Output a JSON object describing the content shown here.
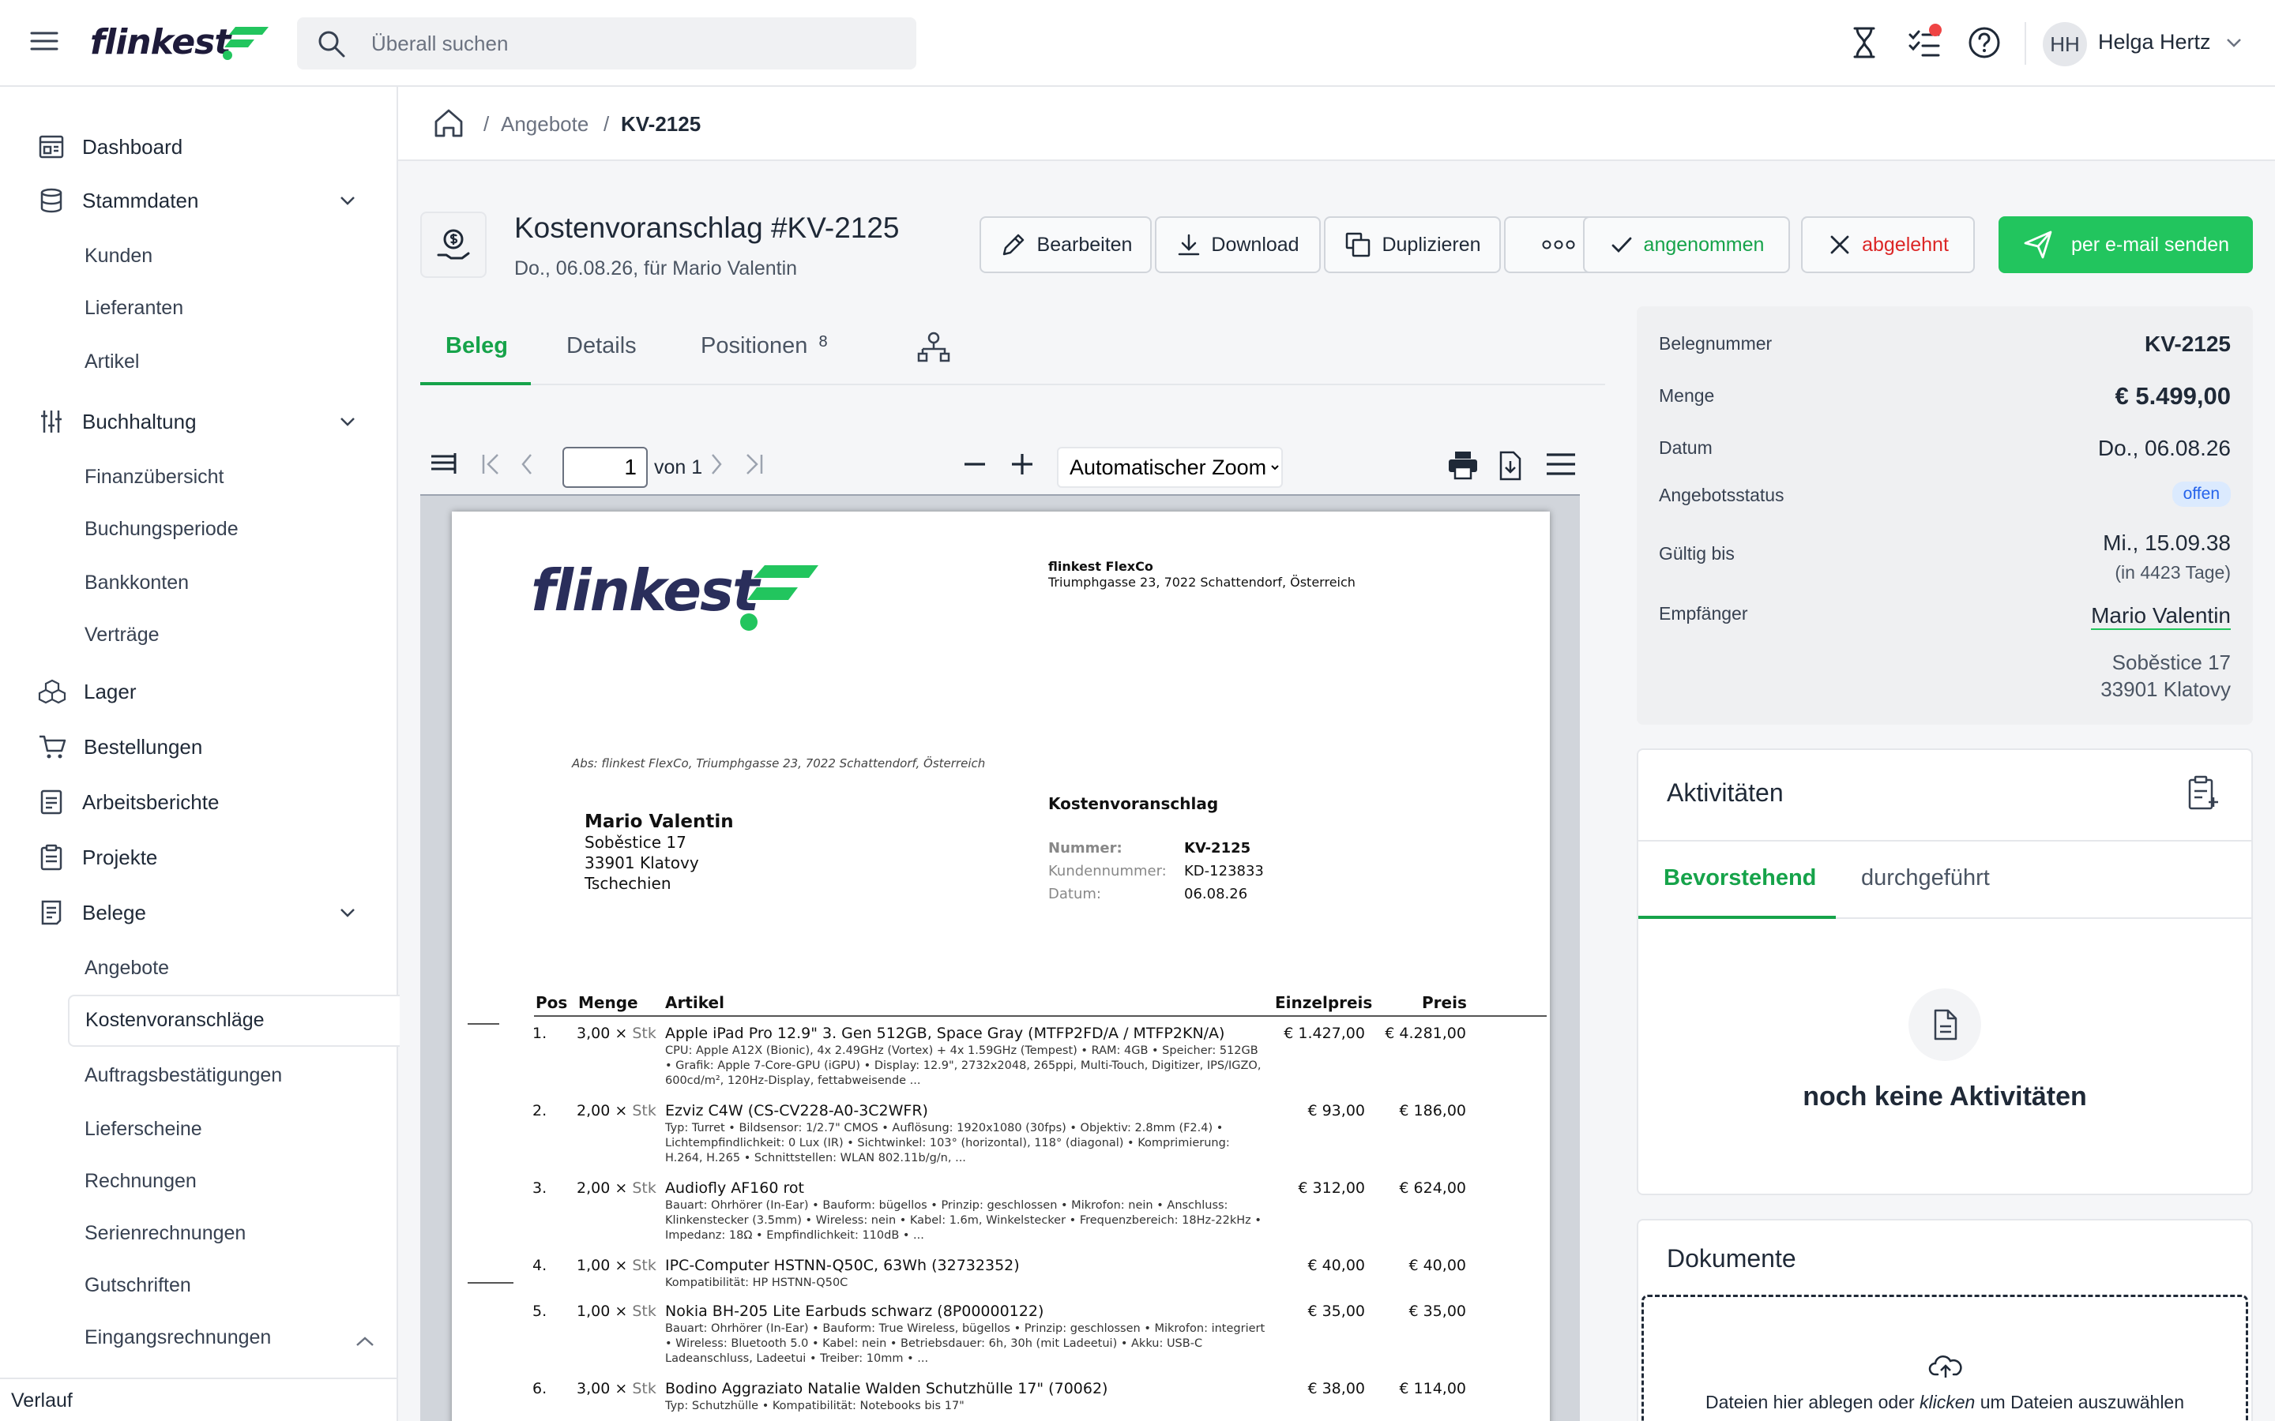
{
  "app": {
    "logo": "flinkest",
    "search_placeholder": "Überall suchen",
    "user_initials": "HH",
    "user_name": "Helga Hertz"
  },
  "sidebar": {
    "items": [
      {
        "label": "Dashboard",
        "icon": "dashboard-icon"
      },
      {
        "label": "Stammdaten",
        "icon": "database-icon",
        "expanded": true
      },
      {
        "label": "Buchhaltung",
        "icon": "sliders-icon",
        "expanded": true
      },
      {
        "label": "Lager",
        "icon": "boxes-icon"
      },
      {
        "label": "Bestellungen",
        "icon": "cart-icon"
      },
      {
        "label": "Arbeitsberichte",
        "icon": "report-icon"
      },
      {
        "label": "Projekte",
        "icon": "clipboard-icon"
      },
      {
        "label": "Belege",
        "icon": "receipt-icon",
        "expanded": true
      }
    ],
    "stammdaten_sub": [
      "Kunden",
      "Lieferanten",
      "Artikel"
    ],
    "buchhaltung_sub": [
      "Finanzübersicht",
      "Buchungsperiode",
      "Bankkonten",
      "Verträge"
    ],
    "belege_sub": [
      "Angebote",
      "Kostenvoranschläge",
      "Auftragsbestätigungen",
      "Lieferscheine",
      "Rechnungen",
      "Serienrechnungen",
      "Gutschriften",
      "Eingangsrechnungen"
    ],
    "active_sub": "Kostenvoranschläge",
    "footer": "Verlauf"
  },
  "breadcrumb": {
    "items": [
      "Angebote",
      "KV-2125"
    ]
  },
  "header": {
    "title": "Kostenvoranschlag #KV-2125",
    "subtitle": "Do., 06.08.26, für Mario Valentin",
    "buttons": {
      "edit": "Bearbeiten",
      "download": "Download",
      "duplicate": "Duplizieren",
      "accepted": "angenommen",
      "rejected": "abgelehnt",
      "email": "per e-mail senden"
    }
  },
  "tabs": {
    "beleg": "Beleg",
    "details": "Details",
    "positionen": "Positionen",
    "positionen_count": "8"
  },
  "pdf_viewer": {
    "page": "1",
    "page_of": "von 1",
    "zoom_options": [
      "Automatischer Zoom"
    ],
    "zoom": "Automatischer Zoom"
  },
  "pdf": {
    "logo": "flinkest",
    "company_name": "flinkest FlexCo",
    "company_address": "Triumphgasse 23, 7022 Schattendorf, Österreich",
    "sender_line": "Abs: flinkest FlexCo, Triumphgasse 23, 7022 Schattendorf, Österreich",
    "recipient": {
      "name": "Mario Valentin",
      "street": "Soběstice 17",
      "city": "33901 Klatovy",
      "country": "Tschechien"
    },
    "doc_type": "Kostenvoranschlag",
    "meta": [
      {
        "key": "Nummer:",
        "value": "KV-2125"
      },
      {
        "key": "Kundennummer:",
        "value": "KD-123833"
      },
      {
        "key": "Datum:",
        "value": "06.08.26"
      }
    ],
    "columns": [
      "Pos",
      "Menge",
      "Artikel",
      "Einzelpreis",
      "Preis"
    ],
    "unit": "Stk",
    "rows": [
      {
        "pos": "1.",
        "menge": "3,00 ×",
        "title": "Apple iPad Pro 12.9\" 3. Gen 512GB, Space Gray (MTFP2FD/A / MTFP2KN/A)",
        "desc": "CPU: Apple A12X (Bionic), 4x 2.49GHz (Vortex) + 4x 1.59GHz (Tempest) • RAM: 4GB • Speicher: 512GB • Grafik: Apple 7-Core-GPU (iGPU) • Display: 12.9\", 2732x2048, 265ppi, Multi-Touch, Digitizer, IPS/IGZO, 600cd/m², 120Hz-Display, fettabweisende ...",
        "einzel": "€ 1.427,00",
        "preis": "€ 4.281,00"
      },
      {
        "pos": "2.",
        "menge": "2,00 ×",
        "title": "Ezviz C4W (CS-CV228-A0-3C2WFR)",
        "desc": "Typ: Turret • Bildsensor: 1/2.7\" CMOS • Auflösung: 1920x1080 (30fps) • Objektiv: 2.8mm (F2.4) • Lichtempfindlichkeit: 0 Lux (IR) • Sichtwinkel: 103° (horizontal), 118° (diagonal) • Komprimierung: H.264, H.265 • Schnittstellen: WLAN 802.11b/g/n, ...",
        "einzel": "€ 93,00",
        "preis": "€ 186,00"
      },
      {
        "pos": "3.",
        "menge": "2,00 ×",
        "title": "Audiofly AF160 rot",
        "desc": "Bauart: Ohrhörer (In-Ear) • Bauform: bügellos • Prinzip: geschlossen • Mikrofon: nein • Anschluss: Klinkenstecker (3.5mm) • Wireless: nein • Kabel: 1.6m, Winkelstecker • Frequenzbereich: 18Hz-22kHz • Impedanz: 18Ω • Empfindlichkeit: 110dB • ...",
        "einzel": "€ 312,00",
        "preis": "€ 624,00"
      },
      {
        "pos": "4.",
        "menge": "1,00 ×",
        "title": "IPC-Computer HSTNN-Q50C, 63Wh (32732352)",
        "desc": "Kompatibilität: HP HSTNN-Q50C",
        "einzel": "€ 40,00",
        "preis": "€ 40,00"
      },
      {
        "pos": "5.",
        "menge": "1,00 ×",
        "title": "Nokia BH-205 Lite Earbuds schwarz (8P00000122)",
        "desc": "Bauart: Ohrhörer (In-Ear) • Bauform: True Wireless, bügellos • Prinzip: geschlossen • Mikrofon: integriert • Wireless: Bluetooth 5.0 • Kabel: nein • Betriebsdauer: 6h, 30h (mit Ladeetui) • Akku: USB-C Ladeanschluss, Ladeetui • Treiber: 10mm • ...",
        "einzel": "€ 35,00",
        "preis": "€ 35,00"
      },
      {
        "pos": "6.",
        "menge": "3,00 ×",
        "title": "Bodino Aggraziato Natalie Walden Schutzhülle 17\" (70062)",
        "desc": "Typ: Schutzhülle • Kompatibilität: Notebooks bis 17\"",
        "einzel": "€ 38,00",
        "preis": "€ 114,00"
      }
    ]
  },
  "info": {
    "belegnummer_label": "Belegnummer",
    "belegnummer": "KV-2125",
    "menge_label": "Menge",
    "menge": "€ 5.499,00",
    "datum_label": "Datum",
    "datum": "Do., 06.08.26",
    "status_label": "Angebotsstatus",
    "status": "offen",
    "gueltig_label": "Gültig bis",
    "gueltig": "Mi., 15.09.38",
    "gueltig_days": "(in 4423 Tage)",
    "empfaenger_label": "Empfänger",
    "empfaenger": "Mario Valentin",
    "empfaenger_street": "Soběstice 17",
    "empfaenger_city": "33901 Klatovy"
  },
  "activities": {
    "title": "Aktivitäten",
    "tab_upcoming": "Bevorstehend",
    "tab_done": "durchgeführt",
    "empty": "noch keine Aktivitäten"
  },
  "documents": {
    "title": "Dokumente",
    "drop_before": "Dateien hier ablegen oder ",
    "drop_link": "klicken",
    "drop_after": " um Dateien auszuwählen"
  },
  "colors": {
    "accent": "#16a34a",
    "primary_button": "#22c55e",
    "danger": "#dc2626",
    "notification": "#ef4444"
  }
}
